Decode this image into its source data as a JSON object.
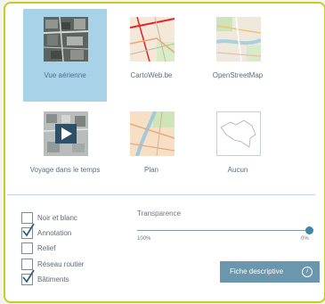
{
  "basemaps": [
    {
      "label": "Vue aérienne",
      "selected": true,
      "icon": "aerial-photo-thumbnail"
    },
    {
      "label": "CartoWeb.be",
      "selected": false,
      "icon": "cartoweb-map-thumbnail"
    },
    {
      "label": "OpenStreetMap",
      "selected": false,
      "icon": "openstreetmap-thumbnail"
    },
    {
      "label": "Voyage dans le temps",
      "selected": false,
      "icon": "time-travel-play-thumbnail"
    },
    {
      "label": "Plan",
      "selected": false,
      "icon": "plan-map-thumbnail"
    },
    {
      "label": "Aucun",
      "selected": false,
      "icon": "belgium-outline-thumbnail"
    }
  ],
  "options": [
    {
      "label": "Noir et blanc",
      "checked": false
    },
    {
      "label": "Annotation",
      "checked": true
    },
    {
      "label": "Relief",
      "checked": false
    },
    {
      "label": "Réseau routier",
      "checked": false
    },
    {
      "label": "Bâtiments",
      "checked": true
    }
  ],
  "transparency": {
    "title": "Transparence",
    "min_label": "100%",
    "max_label": "0%",
    "value_percent": 100
  },
  "fiche_button": {
    "label": "Fiche descriptive",
    "icon": "info-icon"
  },
  "colors": {
    "panel_border": "#c8cc1f",
    "selected_tile": "#a8d2e8",
    "slider_knob": "#3d86a8",
    "button_bg": "#6a97ad"
  }
}
